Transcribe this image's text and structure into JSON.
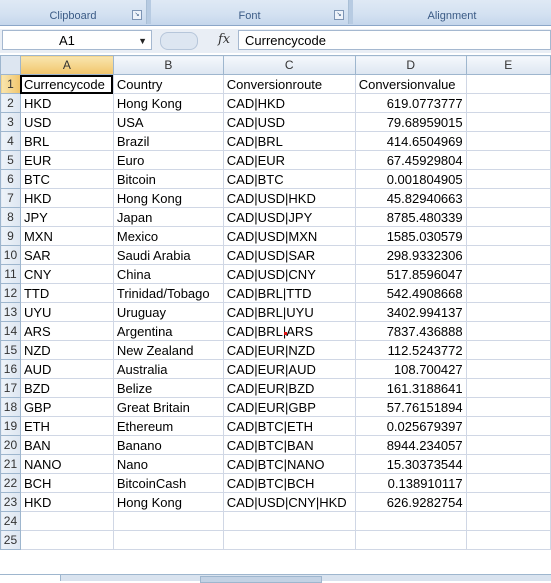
{
  "ribbon": {
    "groups": [
      {
        "label": "Clipboard"
      },
      {
        "label": "Font"
      },
      {
        "label": "Alignment"
      }
    ]
  },
  "formula_bar": {
    "name_box": "A1",
    "fx_label": "fx",
    "formula": "Currencycode"
  },
  "grid": {
    "columns": [
      "A",
      "B",
      "C",
      "D",
      "E"
    ],
    "rows": [
      {
        "n": "1",
        "a": "Currencycode",
        "b": "Country",
        "c": "Conversionroute",
        "d": "Conversionvalue"
      },
      {
        "n": "2",
        "a": "HKD",
        "b": "Hong Kong",
        "c": "CAD|HKD",
        "d": "619.0773777"
      },
      {
        "n": "3",
        "a": "USD",
        "b": "USA",
        "c": "CAD|USD",
        "d": "79.68959015"
      },
      {
        "n": "4",
        "a": "BRL",
        "b": "Brazil",
        "c": "CAD|BRL",
        "d": "414.6504969"
      },
      {
        "n": "5",
        "a": "EUR",
        "b": "Euro",
        "c": "CAD|EUR",
        "d": "67.45929804"
      },
      {
        "n": "6",
        "a": "BTC",
        "b": "Bitcoin",
        "c": "CAD|BTC",
        "d": "0.001804905"
      },
      {
        "n": "7",
        "a": "HKD",
        "b": "Hong Kong",
        "c": "CAD|USD|HKD",
        "d": "45.82940663"
      },
      {
        "n": "8",
        "a": "JPY",
        "b": "Japan",
        "c": "CAD|USD|JPY",
        "d": "8785.480339"
      },
      {
        "n": "9",
        "a": "MXN",
        "b": "Mexico",
        "c": "CAD|USD|MXN",
        "d": "1585.030579"
      },
      {
        "n": "10",
        "a": "SAR",
        "b": "Saudi Arabia",
        "c": "CAD|USD|SAR",
        "d": "298.9332306"
      },
      {
        "n": "11",
        "a": "CNY",
        "b": "China",
        "c": "CAD|USD|CNY",
        "d": "517.8596047"
      },
      {
        "n": "12",
        "a": "TTD",
        "b": "Trinidad/Tobago",
        "c": "CAD|BRL|TTD",
        "d": "542.4908668"
      },
      {
        "n": "13",
        "a": "UYU",
        "b": "Uruguay",
        "c": "CAD|BRL|UYU",
        "d": "3402.994137"
      },
      {
        "n": "14",
        "a": "ARS",
        "b": "Argentina",
        "c": "CAD|BRL|ARS",
        "d": "7837.436888"
      },
      {
        "n": "15",
        "a": "NZD",
        "b": "New Zealand",
        "c": "CAD|EUR|NZD",
        "d": "112.5243772"
      },
      {
        "n": "16",
        "a": "AUD",
        "b": "Australia",
        "c": "CAD|EUR|AUD",
        "d": "108.700427"
      },
      {
        "n": "17",
        "a": "BZD",
        "b": "Belize",
        "c": "CAD|EUR|BZD",
        "d": "161.3188641"
      },
      {
        "n": "18",
        "a": "GBP",
        "b": "Great Britain",
        "c": "CAD|EUR|GBP",
        "d": "57.76151894"
      },
      {
        "n": "19",
        "a": "ETH",
        "b": "Ethereum",
        "c": "CAD|BTC|ETH",
        "d": "0.025679397"
      },
      {
        "n": "20",
        "a": "BAN",
        "b": "Banano",
        "c": "CAD|BTC|BAN",
        "d": "8944.234057"
      },
      {
        "n": "21",
        "a": "NANO",
        "b": "Nano",
        "c": "CAD|BTC|NANO",
        "d": "15.30373544"
      },
      {
        "n": "22",
        "a": "BCH",
        "b": "BitcoinCash",
        "c": "CAD|BTC|BCH",
        "d": "0.138910117"
      },
      {
        "n": "23",
        "a": "HKD",
        "b": "Hong Kong",
        "c": "CAD|USD|CNY|HKD",
        "d": "626.9282754"
      },
      {
        "n": "24",
        "a": "",
        "b": "",
        "c": "",
        "d": ""
      },
      {
        "n": "25",
        "a": "",
        "b": "",
        "c": "",
        "d": ""
      }
    ]
  }
}
